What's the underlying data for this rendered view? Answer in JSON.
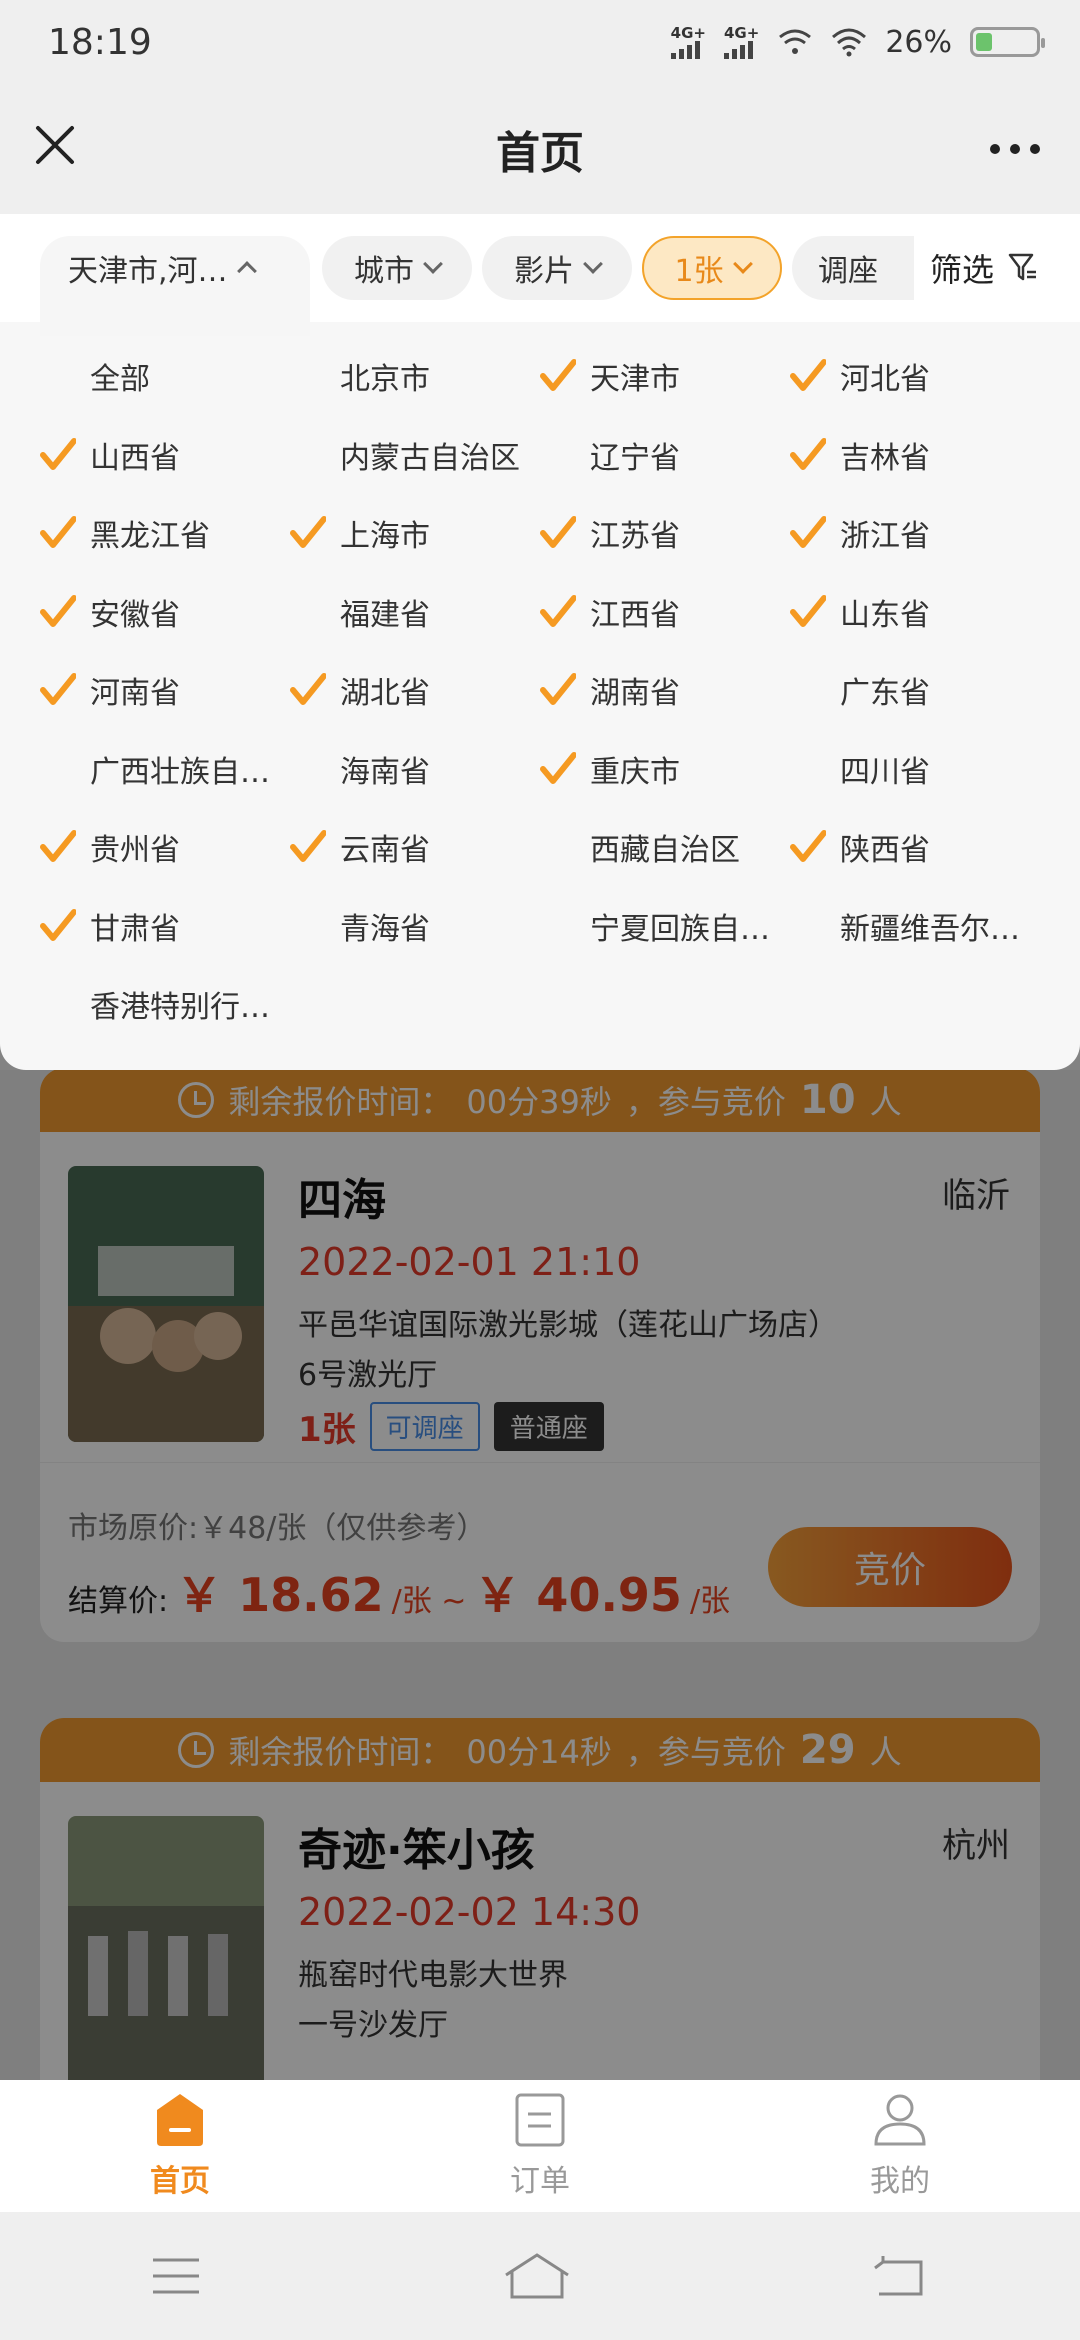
{
  "status_bar": {
    "time": "18:19",
    "net1": "4G+",
    "net2": "4G+",
    "battery": "26%"
  },
  "title_bar": {
    "title": "首页"
  },
  "filters": {
    "region": "天津市,河…",
    "city": "城市",
    "movie": "影片",
    "tickets": "1张",
    "seat": "调座",
    "filter": "筛选"
  },
  "regions": [
    {
      "name": "全部",
      "checked": false
    },
    {
      "name": "北京市",
      "checked": false
    },
    {
      "name": "天津市",
      "checked": true
    },
    {
      "name": "河北省",
      "checked": true
    },
    {
      "name": "山西省",
      "checked": true
    },
    {
      "name": "内蒙古自治区",
      "checked": false
    },
    {
      "name": "辽宁省",
      "checked": false
    },
    {
      "name": "吉林省",
      "checked": true
    },
    {
      "name": "黑龙江省",
      "checked": true
    },
    {
      "name": "上海市",
      "checked": true
    },
    {
      "name": "江苏省",
      "checked": true
    },
    {
      "name": "浙江省",
      "checked": true
    },
    {
      "name": "安徽省",
      "checked": true
    },
    {
      "name": "福建省",
      "checked": false
    },
    {
      "name": "江西省",
      "checked": true
    },
    {
      "name": "山东省",
      "checked": true
    },
    {
      "name": "河南省",
      "checked": true
    },
    {
      "name": "湖北省",
      "checked": true
    },
    {
      "name": "湖南省",
      "checked": true
    },
    {
      "name": "广东省",
      "checked": false
    },
    {
      "name": "广西壮族自…",
      "checked": false
    },
    {
      "name": "海南省",
      "checked": false
    },
    {
      "name": "重庆市",
      "checked": true
    },
    {
      "name": "四川省",
      "checked": false
    },
    {
      "name": "贵州省",
      "checked": true
    },
    {
      "name": "云南省",
      "checked": true
    },
    {
      "name": "西藏自治区",
      "checked": false
    },
    {
      "name": "陕西省",
      "checked": true
    },
    {
      "name": "甘肃省",
      "checked": true
    },
    {
      "name": "青海省",
      "checked": false
    },
    {
      "name": "宁夏回族自…",
      "checked": false
    },
    {
      "name": "新疆维吾尔…",
      "checked": false
    },
    {
      "name": "香港特别行…",
      "checked": false
    }
  ],
  "listings": [
    {
      "timer_prefix": "剩余报价时间：",
      "timer_value": "00分39秒",
      "timer_mid": "，参与竞价",
      "timer_count": "10",
      "timer_suffix": "人",
      "title": "四海",
      "city": "临沂",
      "time": "2022-02-01 21:10",
      "cinema": "平邑华谊国际激光影城（莲花山广场店）",
      "hall": "6号激光厅",
      "qty": "1张",
      "tag1": "可调座",
      "tag2": "普通座",
      "market": "市场原价:￥48/张（仅供参考）",
      "settle_label": "结算价:",
      "price_low": "￥ 18.62",
      "unit1": "/张 ~",
      "price_high": "￥ 40.95",
      "unit2": "/张",
      "bid": "竞价"
    },
    {
      "timer_prefix": "剩余报价时间：",
      "timer_value": "00分14秒",
      "timer_mid": "，参与竞价",
      "timer_count": "29",
      "timer_suffix": "人",
      "title": "奇迹·笨小孩",
      "city": "杭州",
      "time": "2022-02-02 14:30",
      "cinema": "瓶窑时代电影大世界",
      "hall": "一号沙发厅"
    }
  ],
  "tabs": [
    {
      "label": "首页",
      "active": true
    },
    {
      "label": "订单",
      "active": false
    },
    {
      "label": "我的",
      "active": false
    }
  ],
  "colors": {
    "accent": "#f08a1e",
    "check": "#f59a22",
    "price": "#e5421f"
  }
}
